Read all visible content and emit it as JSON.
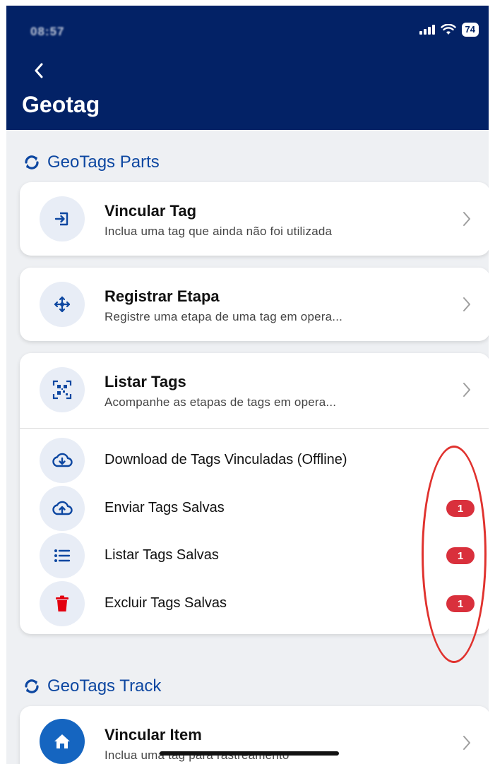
{
  "status_bar": {
    "time": "08:57",
    "battery": "74"
  },
  "header": {
    "back_icon": "chevron-left-icon",
    "title": "Geotag"
  },
  "sections": {
    "parts": {
      "title": "GeoTags Parts",
      "icon": "sync-icon"
    },
    "track": {
      "title": "GeoTags Track",
      "icon": "sync-icon"
    }
  },
  "cards": {
    "vincular_tag": {
      "title": "Vincular Tag",
      "subtitle": "Inclua uma tag que ainda não foi utilizada",
      "icon": "login-icon"
    },
    "registrar_etapa": {
      "title": "Registrar Etapa",
      "subtitle": "Registre uma etapa de uma tag em opera...",
      "icon": "move-arrows-icon"
    },
    "listar_tags": {
      "title": "Listar Tags",
      "subtitle": "Acompanhe as etapas de tags em opera...",
      "icon": "qr-code-icon"
    },
    "offline_actions": [
      {
        "label": "Download de Tags Vinculadas (Offline)",
        "icon": "cloud-download-icon",
        "badge": ""
      },
      {
        "label": "Enviar Tags Salvas",
        "icon": "cloud-upload-icon",
        "badge": "1"
      },
      {
        "label": "Listar Tags Salvas",
        "icon": "list-icon",
        "badge": "1"
      },
      {
        "label": "Excluir Tags Salvas",
        "icon": "trash-icon",
        "badge": "1"
      }
    ],
    "vincular_item": {
      "title": "Vincular Item",
      "subtitle": "Inclua uma tag para rastreamento",
      "icon": "home-icon"
    }
  },
  "colors": {
    "header_bg": "#032266",
    "accent": "#0d47a1",
    "badge": "#d9303c",
    "annotation": "#e0322e",
    "delete_icon": "#e3000f"
  }
}
